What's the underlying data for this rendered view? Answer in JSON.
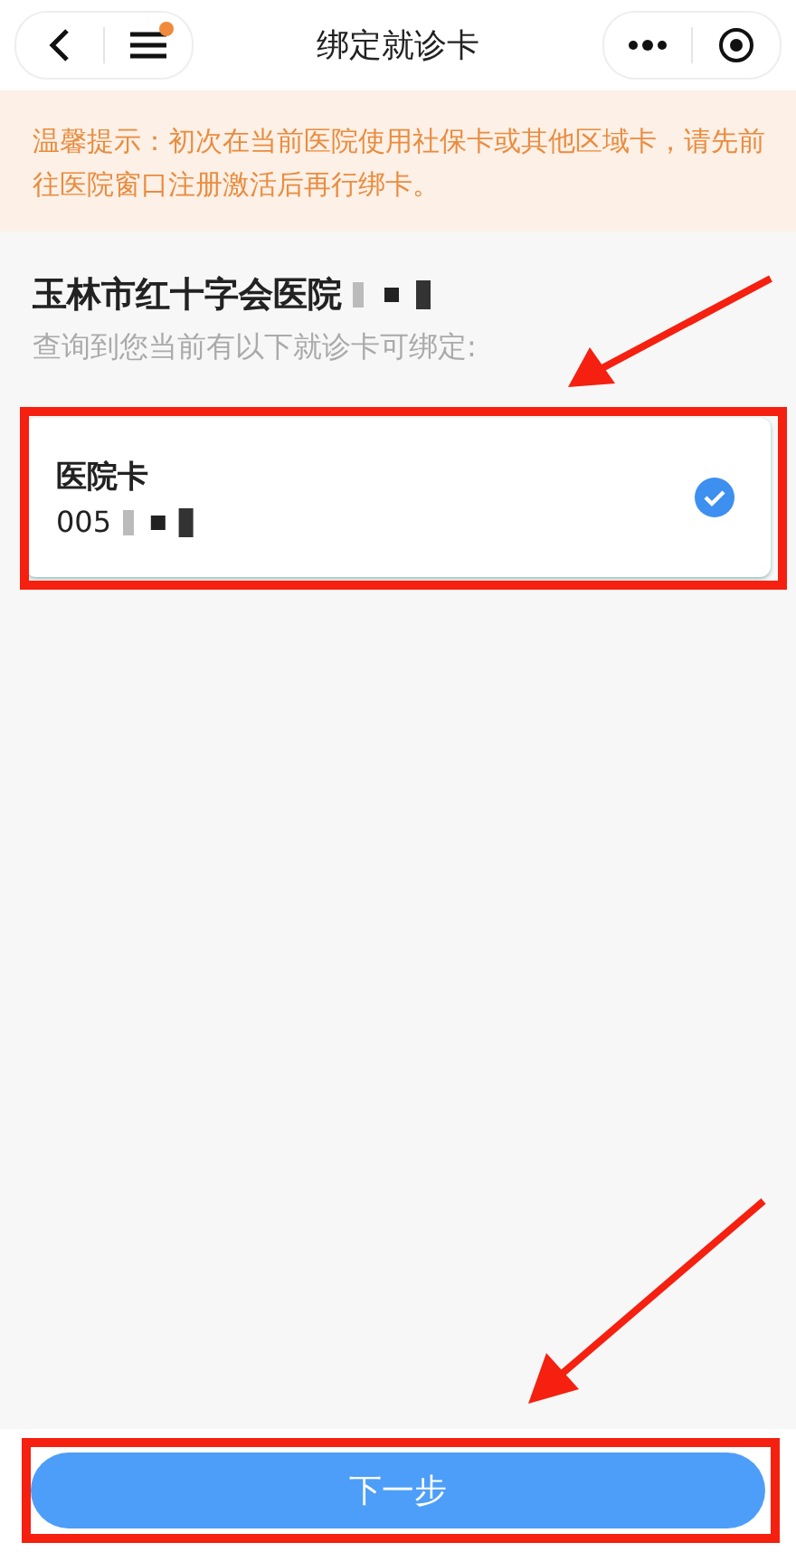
{
  "nav": {
    "title": "绑定就诊卡",
    "menu_badge": true
  },
  "notice": "温馨提示：初次在当前医院使用社保卡或其他区域卡，请先前往医院窗口注册激活后再行绑卡。",
  "hospital": {
    "name": "玉林市红十字会医院",
    "subtitle": "查询到您当前有以下就诊卡可绑定:"
  },
  "cards": [
    {
      "type": "医院卡",
      "number": "005",
      "selected": true
    }
  ],
  "next_button": "下一步"
}
